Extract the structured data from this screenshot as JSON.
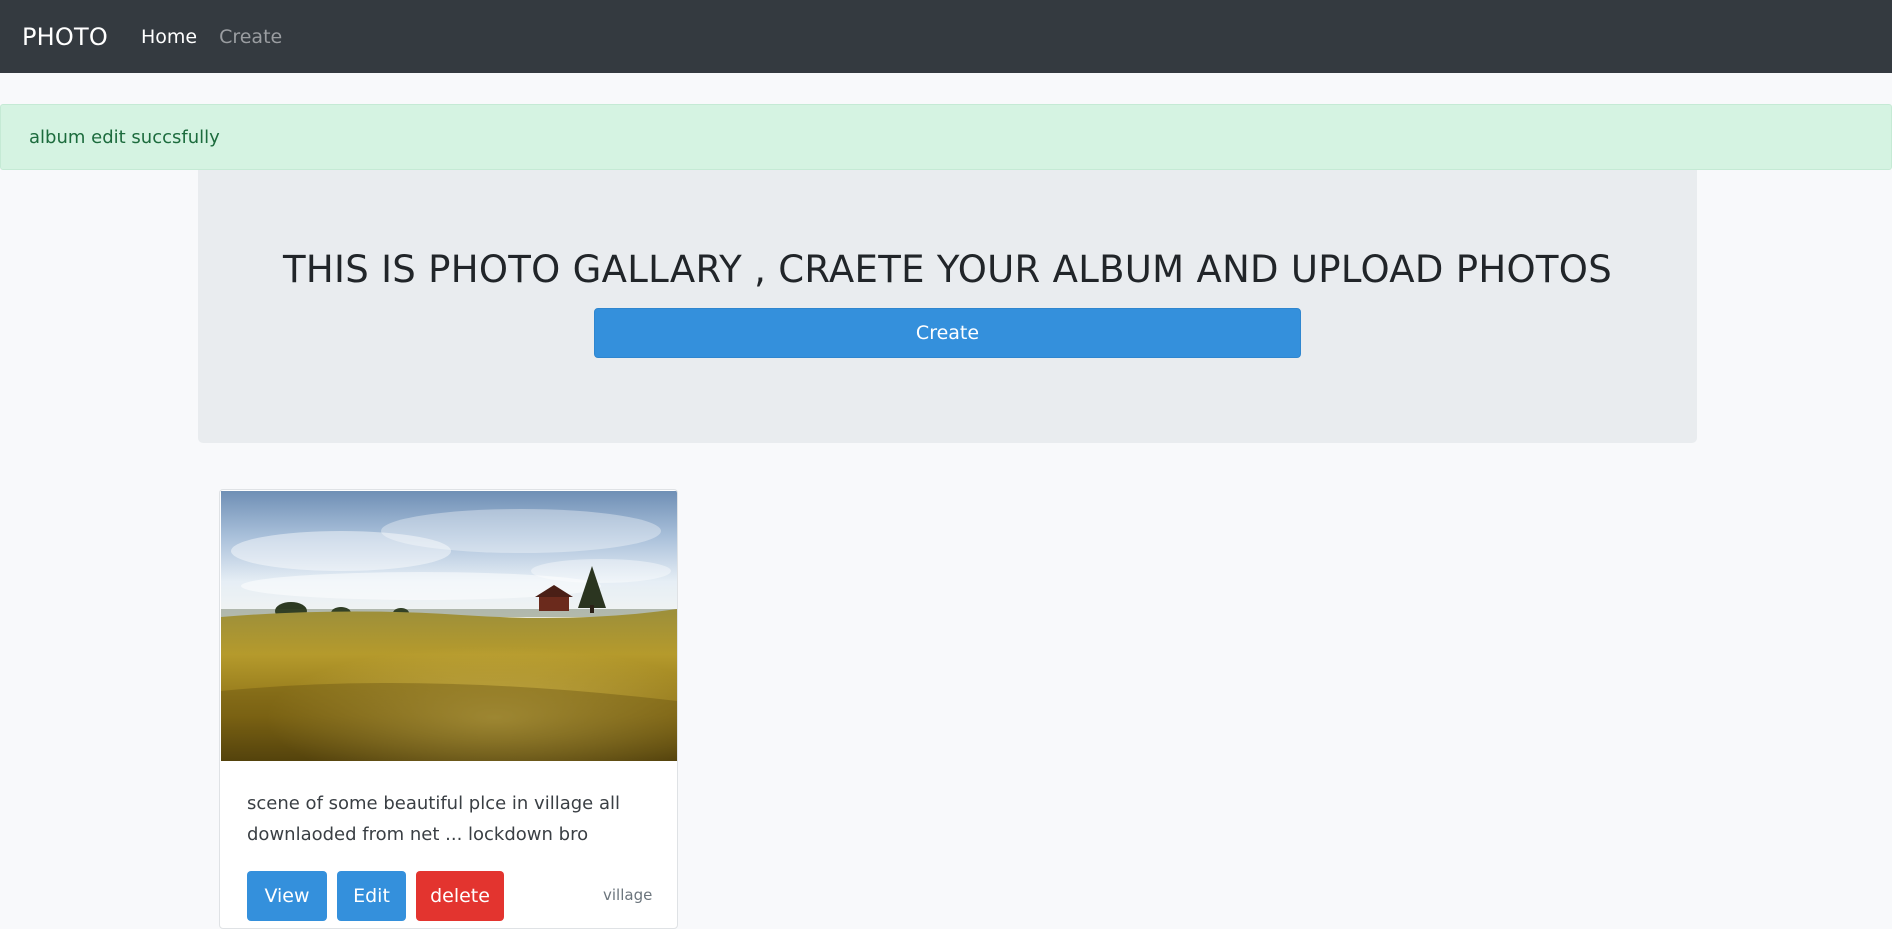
{
  "navbar": {
    "brand": "PHOTO",
    "links": [
      {
        "label": "Home",
        "active": true
      },
      {
        "label": "Create",
        "active": false
      }
    ]
  },
  "alert": {
    "message": "album edit succsfully",
    "status_color": "#d5f3e2"
  },
  "jumbotron": {
    "title": "THIS IS PHOTO GALLARY , CRAETE YOUR ALBUM AND UPLOAD PHOTOS",
    "create_button_label": "Create"
  },
  "albums": [
    {
      "description": "scene of some beautiful plce in village all downlaoded from net ... lockdown bro",
      "tag": "village",
      "buttons": {
        "view": "View",
        "edit": "Edit",
        "delete": "delete"
      }
    }
  ],
  "colors": {
    "navbar_bg": "#343a40",
    "primary": "#3490dc",
    "danger": "#e3342f",
    "jumbotron_bg": "#e9ecef"
  }
}
